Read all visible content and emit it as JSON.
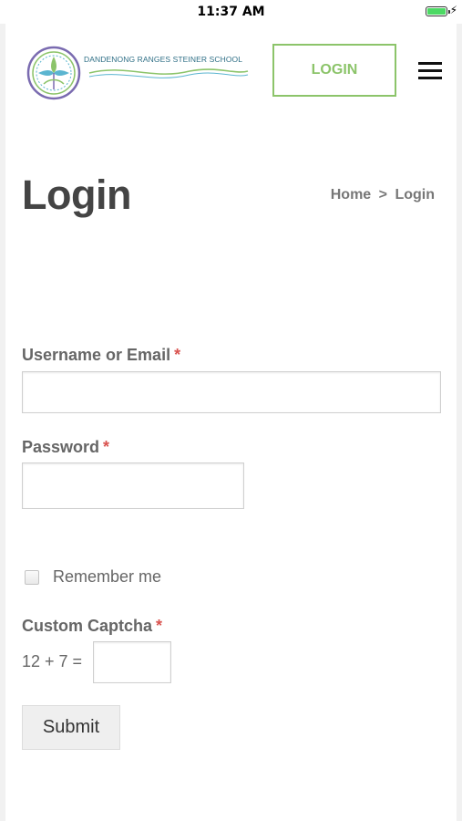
{
  "status_bar": {
    "time": "11:37 AM",
    "battery_level": 1.0
  },
  "header": {
    "logo_text": "DANDENONG RANGES STEINER SCHOOL",
    "login_button": "LOGIN",
    "accent_color": "#8cc46a",
    "menu_icon": "hamburger-menu-icon"
  },
  "page": {
    "title": "Login",
    "breadcrumb": {
      "home": "Home",
      "separator": ">",
      "current": "Login"
    }
  },
  "form": {
    "username_label": "Username or Email",
    "username_value": "",
    "password_label": "Password",
    "password_value": "",
    "required_marker": "*",
    "remember_label": "Remember me",
    "remember_checked": false,
    "captcha_label": "Custom Captcha",
    "captcha_question": "12 + 7 =",
    "captcha_value": "",
    "submit_label": "Submit"
  }
}
